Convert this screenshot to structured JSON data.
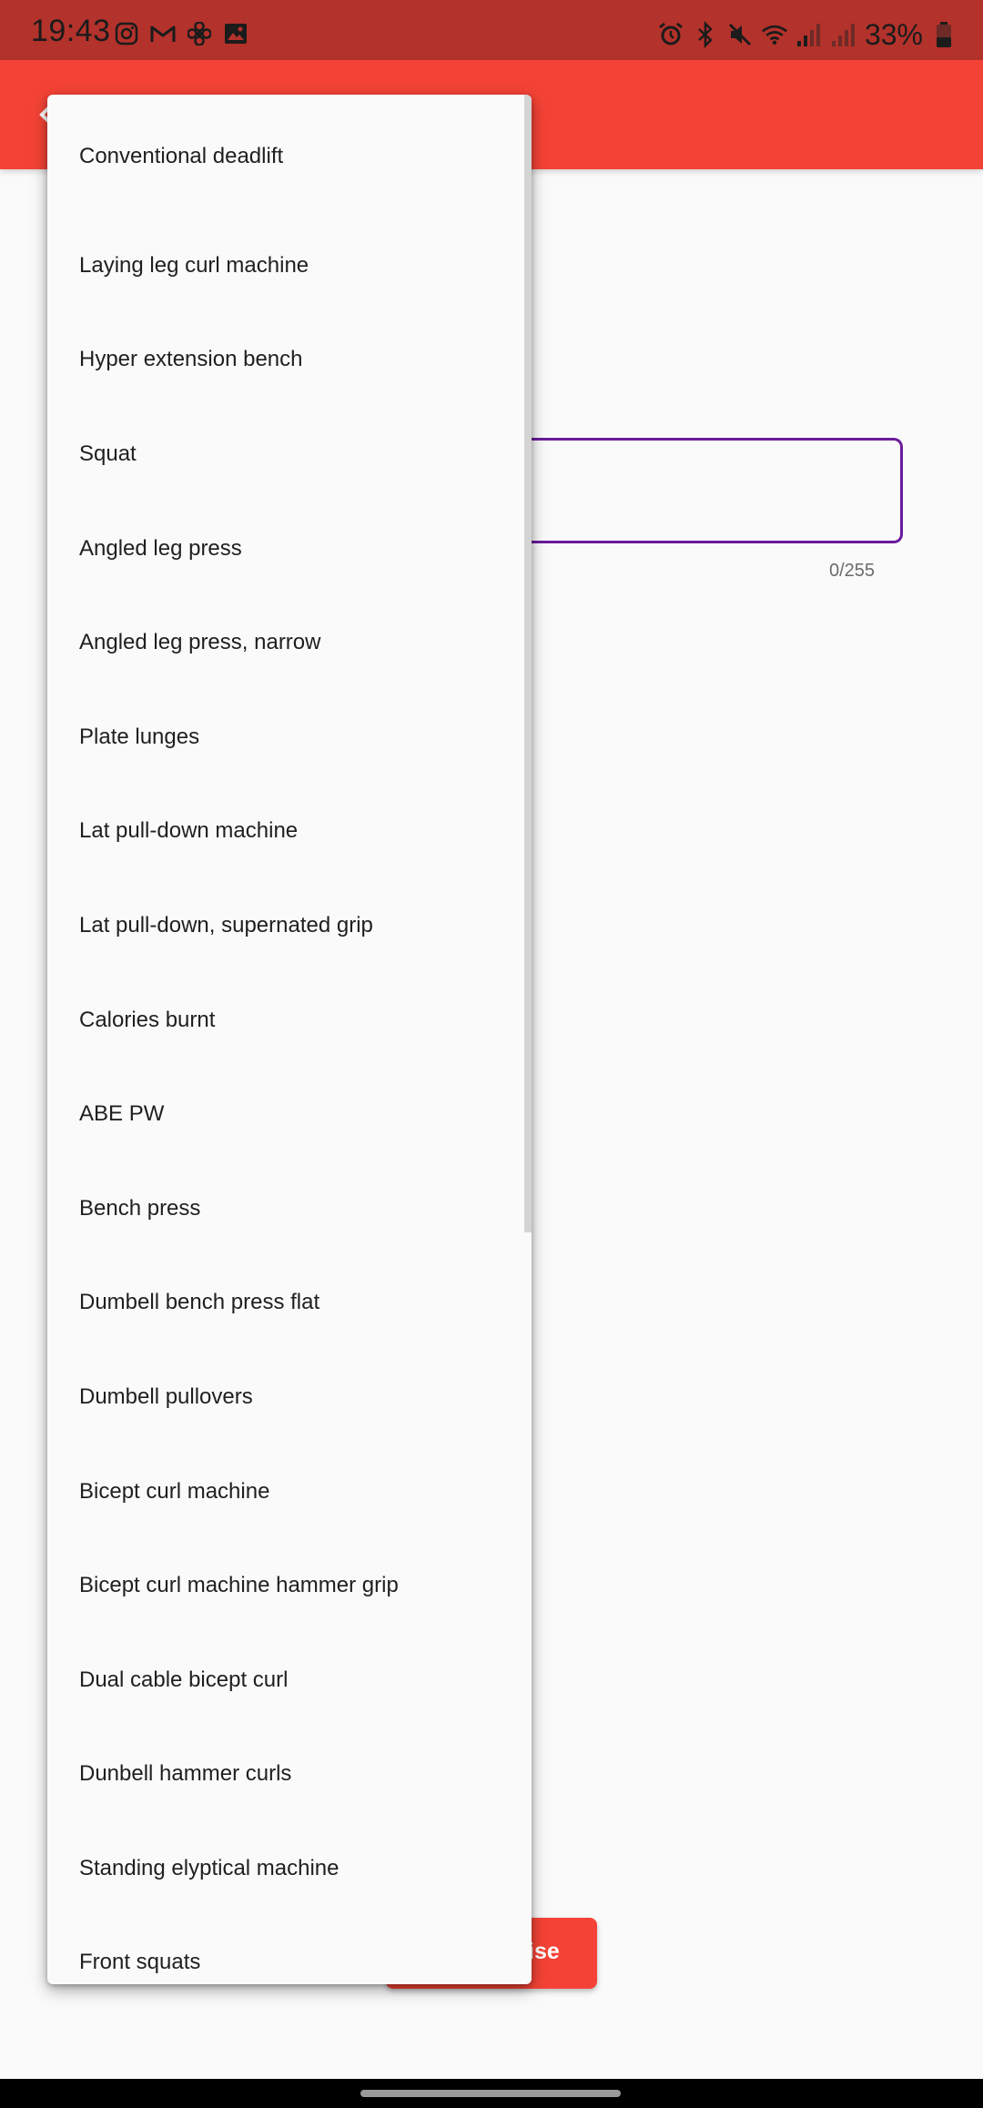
{
  "status_bar": {
    "time": "19:43",
    "battery": "33%",
    "left_icons": [
      "instagram-icon",
      "gmail-icon",
      "fan-icon",
      "image-icon"
    ],
    "right_icons": [
      "alarm-icon",
      "bluetooth-icon",
      "mute-icon",
      "wifi-icon",
      "signal-icon",
      "signal-icon",
      "battery-icon"
    ]
  },
  "form": {
    "char_counter": "0/255",
    "save_button_label": "ise"
  },
  "menu": {
    "items": [
      "Conventional deadlift",
      "Laying leg curl machine",
      "Hyper extension bench",
      "Squat",
      "Angled leg press",
      "Angled leg press, narrow",
      "Plate lunges",
      "Lat pull-down machine",
      "Lat pull-down, supernated grip",
      "Calories burnt",
      "ABE PW",
      "Bench press",
      "Dumbell bench press flat",
      "Dumbell pullovers",
      "Bicept curl machine",
      "Bicept curl machine hammer grip",
      "Dual cable bicept curl",
      "Dunbell hammer curls",
      "Standing elyptical machine",
      "Front squats"
    ]
  },
  "colors": {
    "status_bar": "#b3322b",
    "app_bar": "#f44336",
    "focus_border": "#6a1b9a",
    "menu_background": "#fafafa"
  }
}
